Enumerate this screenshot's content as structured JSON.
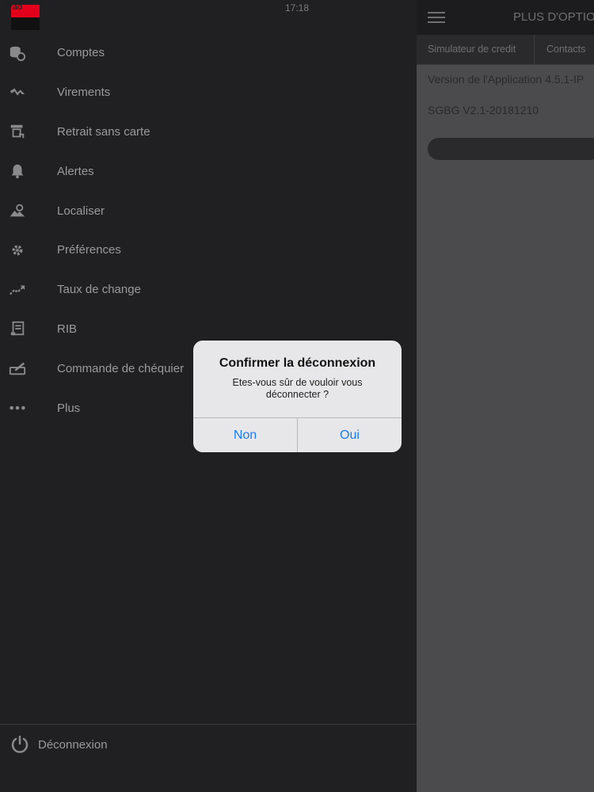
{
  "status_bar": {
    "device": "iPad",
    "time": "17:18"
  },
  "sidebar": {
    "items": [
      {
        "label": "Comptes",
        "icon": "accounts-icon"
      },
      {
        "label": "Virements",
        "icon": "transfer-icon"
      },
      {
        "label": "Retrait sans carte",
        "icon": "cardless-withdrawal-icon"
      },
      {
        "label": "Alertes",
        "icon": "bell-icon"
      },
      {
        "label": "Localiser",
        "icon": "locate-icon"
      },
      {
        "label": "Préférences",
        "icon": "settings-icon"
      },
      {
        "label": "Taux de change",
        "icon": "exchange-rate-icon"
      },
      {
        "label": "RIB",
        "icon": "rib-document-icon"
      },
      {
        "label": "Commande de chéquier",
        "icon": "checkbook-icon"
      },
      {
        "label": "Plus",
        "icon": "more-dots-icon"
      }
    ],
    "logout_label": "Déconnexion"
  },
  "right_panel": {
    "title": "PLUS D'OPTIO",
    "tabs": [
      "Simulateur de credit",
      "Contacts"
    ],
    "version_line": "Version de l'Application 4.5.1-IP",
    "build_line": "SGBG V2.1-20181210"
  },
  "dialog": {
    "title": "Confirmer la déconnexion",
    "message": "Etes-vous sûr de vouloir vous déconnecter ?",
    "cancel_label": "Non",
    "confirm_label": "Oui"
  },
  "colors": {
    "brand_red": "#e2001a",
    "link_blue": "#1a7cf5",
    "sidebar_bg": "#202022"
  }
}
